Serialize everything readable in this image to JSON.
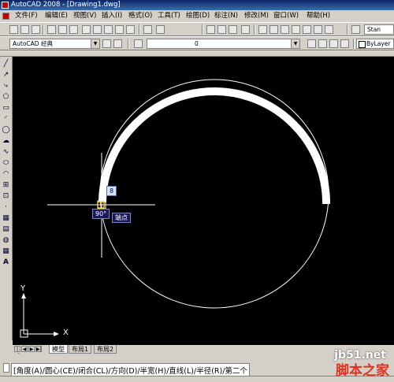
{
  "window": {
    "title": "AutoCAD 2008 - [Drawing1.dwg]"
  },
  "menu": [
    {
      "label": "文件(F)"
    },
    {
      "label": "编辑(E)"
    },
    {
      "label": "视图(V)"
    },
    {
      "label": "插入(I)"
    },
    {
      "label": "格式(O)"
    },
    {
      "label": "工具(T)"
    },
    {
      "label": "绘图(D)"
    },
    {
      "label": "标注(N)"
    },
    {
      "label": "修改(M)"
    },
    {
      "label": "窗口(W)"
    },
    {
      "label": "帮助(H)"
    }
  ],
  "toolbar": {
    "workspace": "AutoCAD 经典",
    "layer": "0",
    "color_combo": "ByLayer",
    "style_partial": "Stan"
  },
  "drawing": {
    "ucs_y": "Y",
    "ucs_x": "X",
    "tooltip_value": "8",
    "angle_tip": "90°",
    "snap_tip": "端点"
  },
  "layout_tabs": [
    {
      "label": "模型",
      "active": true
    },
    {
      "label": "布局1",
      "active": false
    },
    {
      "label": "布局2",
      "active": false
    }
  ],
  "command": {
    "options": "[角度(A)/圆心(CE)/闭合(CL)/方向(D)/半宽(H)/直线(L)/半径(R)/第二个"
  },
  "watermark": {
    "site": "jb51.net",
    "name": "脚本之家"
  },
  "colors": {
    "canvas": "#000000",
    "ui": "#d4d0c8",
    "title": "#0a246a"
  }
}
